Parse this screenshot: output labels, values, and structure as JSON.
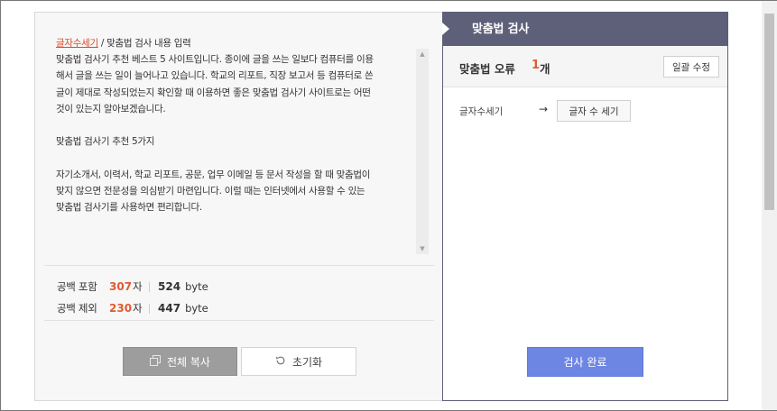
{
  "editor": {
    "link_text": "글자수세기",
    "title_suffix": " / 맞춤법 검사 내용 입력",
    "paragraphs": [
      "맞춤법 검사기 추천 베스트 5 사이트입니다. 종이에 글을 쓰는 일보다 컴퓨터를 이용",
      "해서 글을 쓰는 일이 늘어나고 있습니다. 학교의 리포트, 직장 보고서 등 컴퓨터로 쓴",
      "글이 제대로 작성되었는지 확인할 때 이용하면 좋은 맞춤법 검사기 사이트로는 어떤",
      "것이 있는지 알아보겠습니다.",
      "",
      "맞춤법 검사기 추천 5가지",
      "",
      "자기소개서, 이력서, 학교 리포트, 공문, 업무 이메일 등 문서 작성을 할 때 맞춤법이",
      "맞지 않으면 전문성을 의심받기 마련입니다. 이럴 때는 인터넷에서 사용할 수 있는",
      "맞춤법 검사기를 사용하면 편리합니다."
    ]
  },
  "counts": {
    "with_space": {
      "label": "공백 포함",
      "chars": "307",
      "char_unit": "자",
      "bytes": "524",
      "byte_unit": "byte"
    },
    "without_space": {
      "label": "공백 제외",
      "chars": "230",
      "char_unit": "자",
      "bytes": "447",
      "byte_unit": "byte"
    }
  },
  "buttons": {
    "copy_all": "전체 복사",
    "reset": "초기화",
    "fix_all": "일괄 수정",
    "done": "검사 완료"
  },
  "result": {
    "header": "맞춤법 검사",
    "error_label": "맞춤법 오류",
    "error_count": "1",
    "error_unit": "개",
    "suggestion": {
      "original": "글자수세기",
      "arrow": "→",
      "correction": "글자 수 세기"
    }
  },
  "colors": {
    "accent": "#e05a32",
    "header_bg": "#5e6079",
    "done_button": "#6d86e3",
    "copy_button": "#9d9d9d"
  }
}
